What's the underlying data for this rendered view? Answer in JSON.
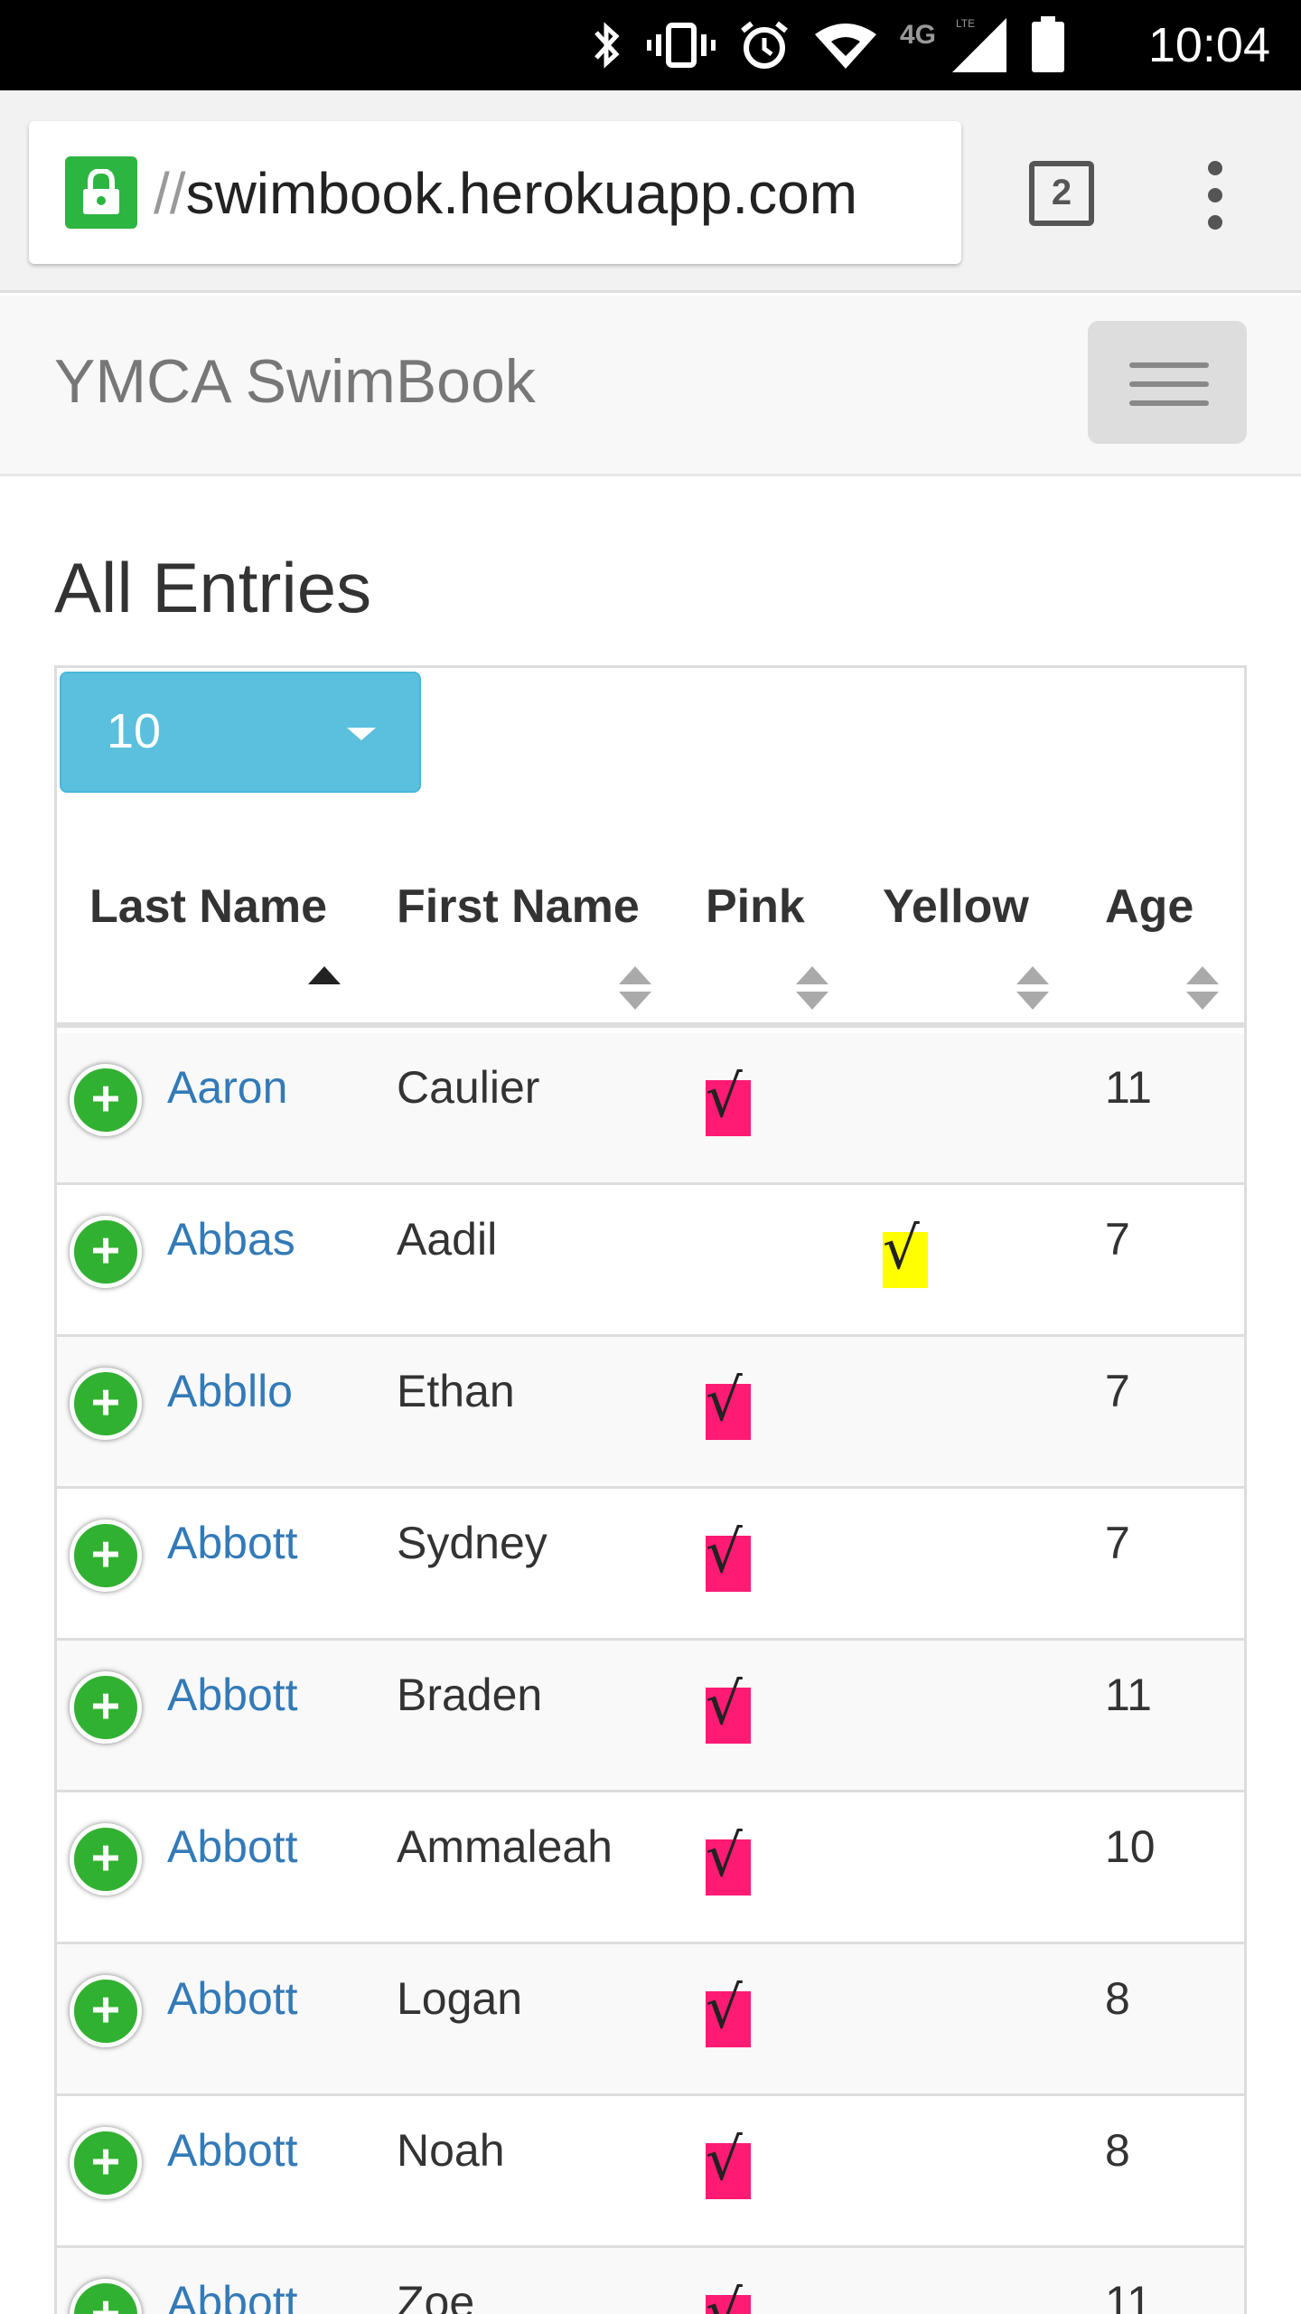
{
  "status_bar": {
    "time": "10:04",
    "icons": [
      "bluetooth-icon",
      "vibrate-icon",
      "alarm-icon",
      "wifi-icon",
      "4g-lte-icon",
      "signal-icon",
      "battery-icon"
    ],
    "network_label": "4G"
  },
  "browser": {
    "url_prefix": "//",
    "url": "swimbook.herokuapp.com",
    "tab_count": "2",
    "secure_color": "#2db541"
  },
  "navbar": {
    "brand": "YMCA SwimBook"
  },
  "page": {
    "title": "All Entries"
  },
  "table": {
    "length_value": "10",
    "length_color": "#5bc0de",
    "columns": [
      "Last Name",
      "First Name",
      "Pink",
      "Yellow",
      "Age"
    ],
    "sorted_column": "Last Name",
    "sort_direction": "ascending",
    "checkmark": "√",
    "pink_color": "#ff1a73",
    "yellow_color": "#ffff00",
    "rows": [
      {
        "last": "Aaron",
        "first": "Caulier",
        "pink": true,
        "yellow": false,
        "age": "11"
      },
      {
        "last": "Abbas",
        "first": "Aadil",
        "pink": false,
        "yellow": true,
        "age": "7"
      },
      {
        "last": "Abbllo",
        "first": "Ethan",
        "pink": true,
        "yellow": false,
        "age": "7"
      },
      {
        "last": "Abbott",
        "first": "Sydney",
        "pink": true,
        "yellow": false,
        "age": "7"
      },
      {
        "last": "Abbott",
        "first": "Braden",
        "pink": true,
        "yellow": false,
        "age": "11"
      },
      {
        "last": "Abbott",
        "first": "Ammaleah",
        "pink": true,
        "yellow": false,
        "age": "10"
      },
      {
        "last": "Abbott",
        "first": "Logan",
        "pink": true,
        "yellow": false,
        "age": "8"
      },
      {
        "last": "Abbott",
        "first": "Noah",
        "pink": true,
        "yellow": false,
        "age": "8"
      },
      {
        "last": "Abbott",
        "first": "Zoe",
        "pink": true,
        "yellow": false,
        "age": "11"
      }
    ]
  }
}
